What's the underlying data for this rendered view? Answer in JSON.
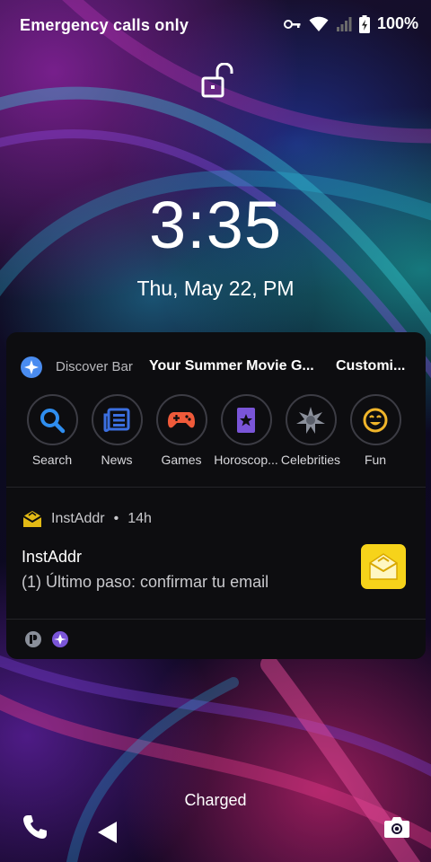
{
  "status_bar": {
    "carrier": "Emergency calls only",
    "battery_percent": "100%",
    "icons": [
      "vpn-key-icon",
      "wifi-icon",
      "signal-icon",
      "battery-charging-icon"
    ]
  },
  "lockscreen": {
    "lock_icon": "unlocked-padlock-icon",
    "time": "3:35",
    "date": "Thu, May 22, PM"
  },
  "discover_bar": {
    "title": "Discover Bar",
    "items": [
      "Your Summer Movie G...",
      "Customi..."
    ],
    "categories": [
      {
        "label": "Search",
        "icon": "search-icon",
        "color": "#2f8ef0"
      },
      {
        "label": "News",
        "icon": "news-icon",
        "color": "#3b6fe0"
      },
      {
        "label": "Games",
        "icon": "gamepad-icon",
        "color": "#ef5a3a"
      },
      {
        "label": "Horoscop...",
        "icon": "horoscope-card-icon",
        "color": "#7a55d8"
      },
      {
        "label": "Celebrities",
        "icon": "celebrity-star-icon",
        "color": "#8a8f9a"
      },
      {
        "label": "Fun",
        "icon": "smiley-icon",
        "color": "#f0b52a"
      }
    ]
  },
  "notification": {
    "app_name": "InstAddr",
    "time": "14h",
    "separator": "•",
    "title": "InstAddr",
    "text": "(1) Último paso: confirmar tu email",
    "thumb_color": "#f6d31a"
  },
  "bottom": {
    "charging_status": "Charged"
  },
  "colors": {
    "card_bg": "#0d0d10",
    "accent_yellow": "#f6d31a"
  }
}
